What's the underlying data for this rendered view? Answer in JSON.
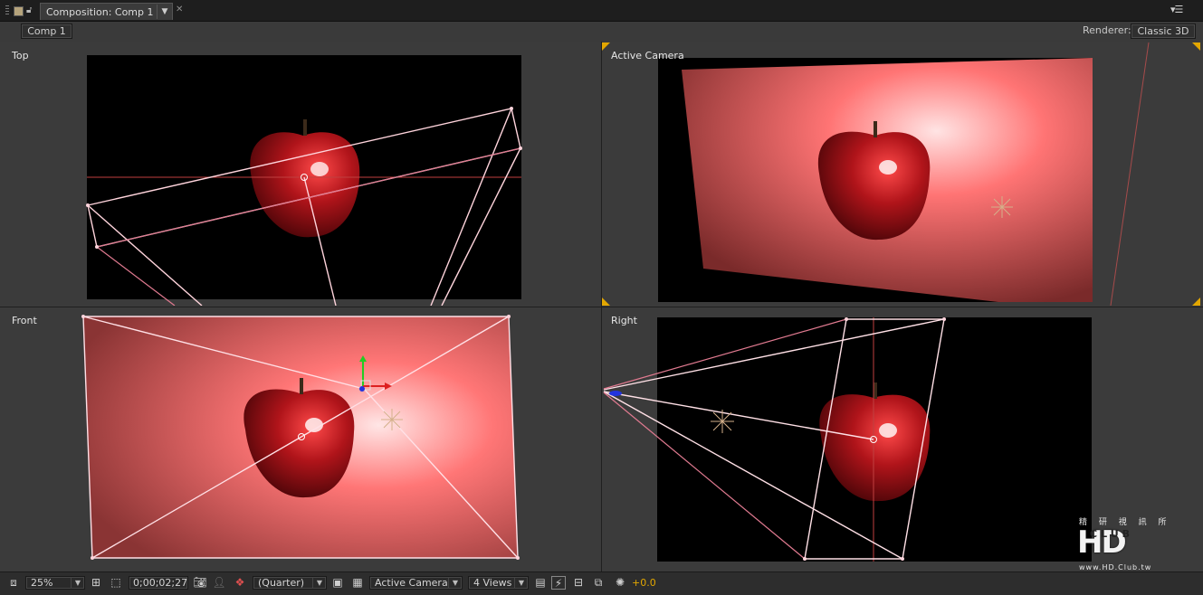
{
  "tab": {
    "title": "Composition: Comp 1"
  },
  "header": {
    "comp_button": "Comp 1",
    "renderer_label": "Renderer:",
    "renderer_value": "Classic 3D"
  },
  "views": {
    "top_left": "Top",
    "top_right": "Active Camera",
    "bottom_left": "Front",
    "bottom_right": "Right"
  },
  "toolbar": {
    "magnification": "25%",
    "timecode": "0;00;02;27",
    "resolution": "(Quarter)",
    "camera_view": "Active Camera",
    "view_layout": "4 Views",
    "exposure": "+0.0"
  },
  "watermark": {
    "top_text": "精 研 視 訊 所",
    "logo": "HD",
    "club": "CLUB",
    "url": "www.HD.Club.tw"
  },
  "colors": {
    "accent_orange": "#e3a700",
    "camera_wire": "#ffc8d0",
    "solid_pink": "#ff6f6f"
  },
  "icons": [
    "grip-icon",
    "lock-icon",
    "panel-menu-icon",
    "always-preview-icon",
    "grid-icon",
    "region-icon",
    "snapshot-icon",
    "show-snapshot-icon",
    "channel-icon",
    "fast-preview-icon",
    "transparency-grid-icon",
    "toggle-view-icon",
    "flowchart-icon",
    "exposure-icon"
  ]
}
